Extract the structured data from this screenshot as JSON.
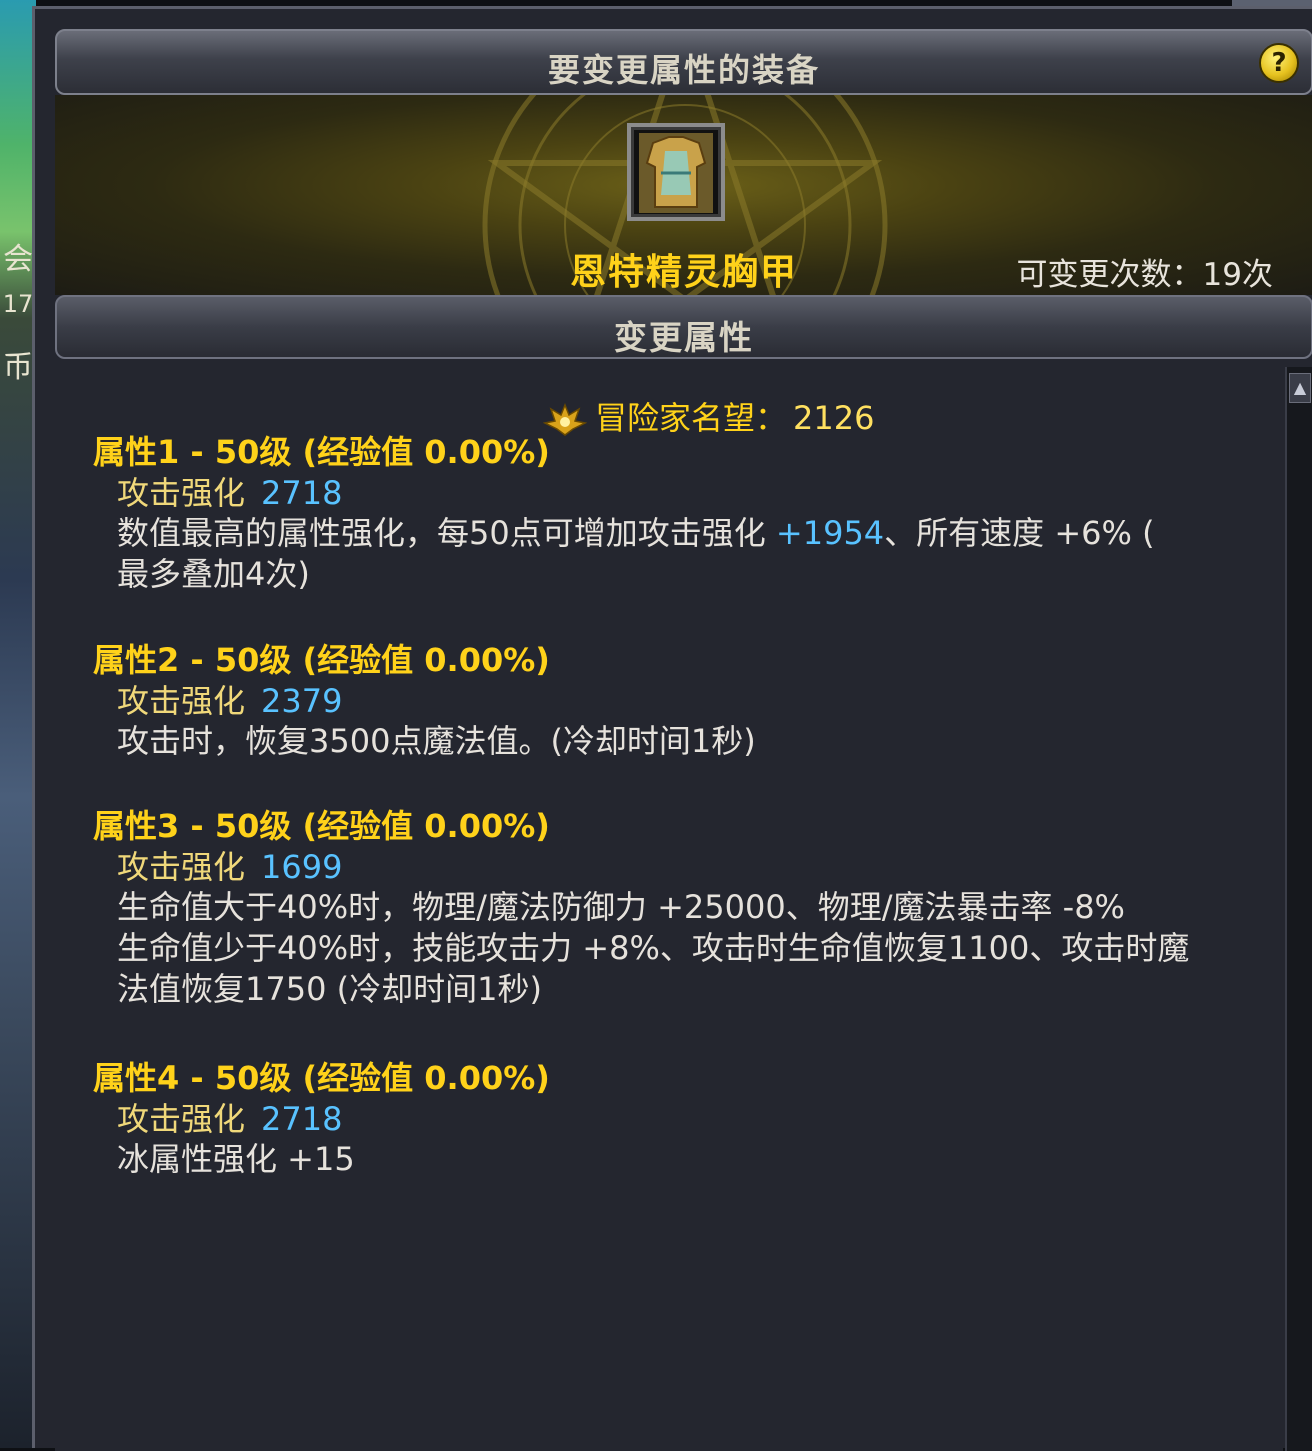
{
  "window": {
    "header_title": "要变更属性的装备",
    "help_label": "?",
    "item_name": "恩特精灵胸甲",
    "change_count_label": "可变更次数：",
    "change_count_value": "19次",
    "section_title": "变更属性"
  },
  "fame": {
    "label": "冒险家名望",
    "separator": "：",
    "value": "2126"
  },
  "attributes": [
    {
      "header": "属性1 - 50级 (经验值 0.00%)",
      "enh_label": "攻击强化",
      "enh_value": "2718",
      "desc_parts": [
        "数值最高的属性强化，每50点可增加攻击强化 ",
        "+1954",
        "、所有速度 +6% (",
        "最多叠加4次)"
      ]
    },
    {
      "header": "属性2 - 50级 (经验值 0.00%)",
      "enh_label": "攻击强化",
      "enh_value": "2379",
      "desc": "攻击时，恢复3500点魔法值。(冷却时间1秒)"
    },
    {
      "header": "属性3 - 50级 (经验值 0.00%)",
      "enh_label": "攻击强化",
      "enh_value": "1699",
      "desc_line1": "生命值大于40%时，物理/魔法防御力 +25000、物理/魔法暴击率 -8%",
      "desc_line2": "生命值少于40%时，技能攻击力 +8%、攻击时生命值恢复1100、攻击时魔",
      "desc_line3": "法值恢复1750 (冷却时间1秒)"
    },
    {
      "header": "属性4 - 50级 (经验值 0.00%)",
      "enh_label": "攻击强化",
      "enh_value": "2718",
      "desc": "冰属性强化 +15"
    }
  ],
  "background": {
    "edge_text": [
      "会",
      "17",
      "币"
    ]
  },
  "colors": {
    "gold": "#ffd21a",
    "blue": "#59c2ff",
    "panel": "#24262f",
    "text": "#e6e2dc"
  }
}
